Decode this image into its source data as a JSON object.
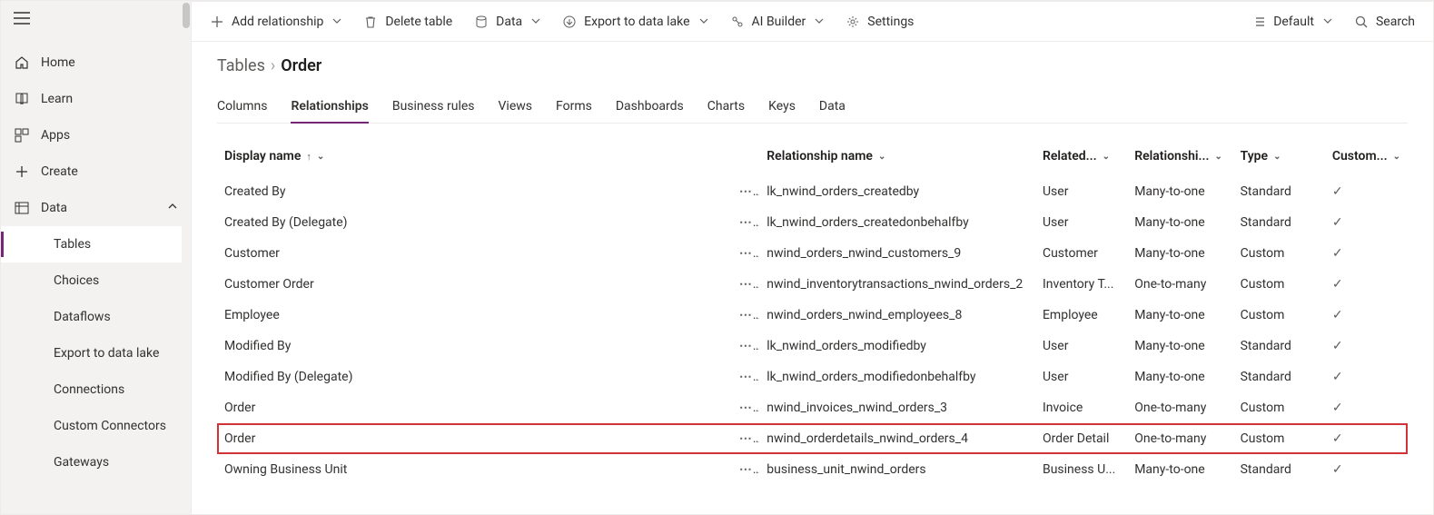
{
  "sidebar": {
    "items": [
      {
        "label": "Home"
      },
      {
        "label": "Learn"
      },
      {
        "label": "Apps"
      },
      {
        "label": "Create"
      },
      {
        "label": "Data"
      }
    ],
    "subitems": [
      {
        "label": "Tables"
      },
      {
        "label": "Choices"
      },
      {
        "label": "Dataflows"
      },
      {
        "label": "Export to data lake"
      },
      {
        "label": "Connections"
      },
      {
        "label": "Custom Connectors"
      },
      {
        "label": "Gateways"
      }
    ]
  },
  "commandbar": {
    "add": "Add relationship",
    "delete": "Delete table",
    "data": "Data",
    "export": "Export to data lake",
    "ai": "AI Builder",
    "settings": "Settings",
    "view": "Default",
    "search": "Search"
  },
  "breadcrumb": {
    "root": "Tables",
    "leaf": "Order"
  },
  "tabs": [
    "Columns",
    "Relationships",
    "Business rules",
    "Views",
    "Forms",
    "Dashboards",
    "Charts",
    "Keys",
    "Data"
  ],
  "table": {
    "headers": {
      "display": "Display name",
      "relname": "Relationship name",
      "related": "Related...",
      "reltype": "Relationshi...",
      "type": "Type",
      "custom": "Custom..."
    },
    "rows": [
      {
        "display": "Created By",
        "rel": "lk_nwind_orders_createdby",
        "related": "User",
        "reltype": "Many-to-one",
        "type": "Standard",
        "custom": true
      },
      {
        "display": "Created By (Delegate)",
        "rel": "lk_nwind_orders_createdonbehalfby",
        "related": "User",
        "reltype": "Many-to-one",
        "type": "Standard",
        "custom": true
      },
      {
        "display": "Customer",
        "rel": "nwind_orders_nwind_customers_9",
        "related": "Customer",
        "reltype": "Many-to-one",
        "type": "Custom",
        "custom": true
      },
      {
        "display": "Customer Order",
        "rel": "nwind_inventorytransactions_nwind_orders_2",
        "related": "Inventory T...",
        "reltype": "One-to-many",
        "type": "Custom",
        "custom": true
      },
      {
        "display": "Employee",
        "rel": "nwind_orders_nwind_employees_8",
        "related": "Employee",
        "reltype": "Many-to-one",
        "type": "Custom",
        "custom": true
      },
      {
        "display": "Modified By",
        "rel": "lk_nwind_orders_modifiedby",
        "related": "User",
        "reltype": "Many-to-one",
        "type": "Standard",
        "custom": true
      },
      {
        "display": "Modified By (Delegate)",
        "rel": "lk_nwind_orders_modifiedonbehalfby",
        "related": "User",
        "reltype": "Many-to-one",
        "type": "Standard",
        "custom": true
      },
      {
        "display": "Order",
        "rel": "nwind_invoices_nwind_orders_3",
        "related": "Invoice",
        "reltype": "One-to-many",
        "type": "Custom",
        "custom": true
      },
      {
        "display": "Order",
        "rel": "nwind_orderdetails_nwind_orders_4",
        "related": "Order Detail",
        "reltype": "One-to-many",
        "type": "Custom",
        "custom": true,
        "highlight": true
      },
      {
        "display": "Owning Business Unit",
        "rel": "business_unit_nwind_orders",
        "related": "Business U...",
        "reltype": "Many-to-one",
        "type": "Standard",
        "custom": true
      }
    ]
  }
}
